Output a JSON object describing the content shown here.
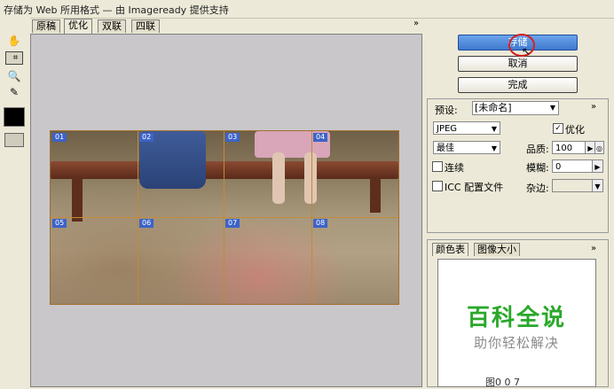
{
  "window": {
    "title": "存储为 Web 所用格式 — 由 Imageready 提供支持"
  },
  "tabs": [
    {
      "label": "原稿"
    },
    {
      "label": "优化"
    },
    {
      "label": "双联"
    },
    {
      "label": "四联"
    }
  ],
  "tab_overflow": "»",
  "slices": [
    "01",
    "02",
    "03",
    "04",
    "05",
    "06",
    "07",
    "08"
  ],
  "buttons": {
    "save": "存储",
    "cancel": "取消",
    "done": "完成"
  },
  "preset": {
    "label": "预设:",
    "value": "[未命名]",
    "overflow": "»",
    "format": "JPEG",
    "quality_level": "最佳",
    "optimized_label": "优化",
    "optimized_checked": true,
    "quality_label": "品质:",
    "quality_value": "100",
    "progressive_label": "连续",
    "progressive_checked": false,
    "blur_label": "模糊:",
    "blur_value": "0",
    "icc_label": "ICC 配置文件",
    "icc_checked": false,
    "matte_label": "杂边:",
    "matte_value": ""
  },
  "color_panel": {
    "tabs": [
      {
        "label": "颜色表"
      },
      {
        "label": "图像大小"
      }
    ],
    "overflow": "»",
    "footer": "图0 0 7"
  },
  "watermark": {
    "title": "百科全说",
    "subtitle": "助你轻松解决"
  },
  "tools": {
    "hand": "✋",
    "slice": "⌗",
    "zoom": "🔍",
    "eyedropper": "✎"
  },
  "colors": {
    "accent_button": "#3f79cf",
    "slice_badge": "#3c63c8",
    "slice_line": "#c08a3c",
    "watermark_green": "#2aa82a"
  }
}
